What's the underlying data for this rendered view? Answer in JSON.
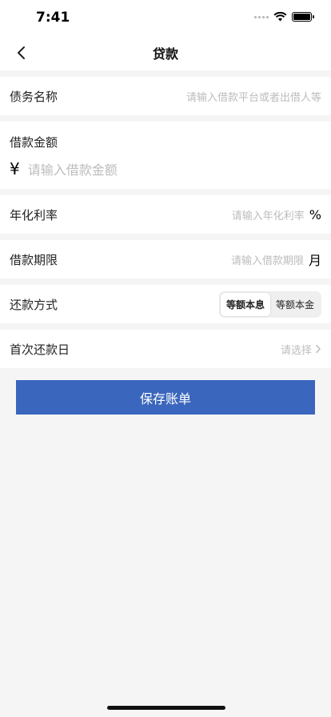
{
  "status": {
    "time": "7:41"
  },
  "nav": {
    "title": "贷款"
  },
  "form": {
    "debt_name": {
      "label": "债务名称",
      "placeholder": "请输入借款平台或者出借人等"
    },
    "amount": {
      "label": "借款金额",
      "currency": "¥",
      "placeholder": "请输入借款金额"
    },
    "rate": {
      "label": "年化利率",
      "placeholder": "请输入年化利率",
      "unit": "%"
    },
    "term": {
      "label": "借款期限",
      "placeholder": "请输入借款期限",
      "unit": "月"
    },
    "repay_method": {
      "label": "还款方式",
      "options": [
        "等额本息",
        "等额本金"
      ],
      "selected": "等额本息"
    },
    "first_day": {
      "label": "首次还款日",
      "placeholder": "请选择"
    }
  },
  "save_label": "保存账单",
  "colors": {
    "primary": "#3a66bd"
  }
}
